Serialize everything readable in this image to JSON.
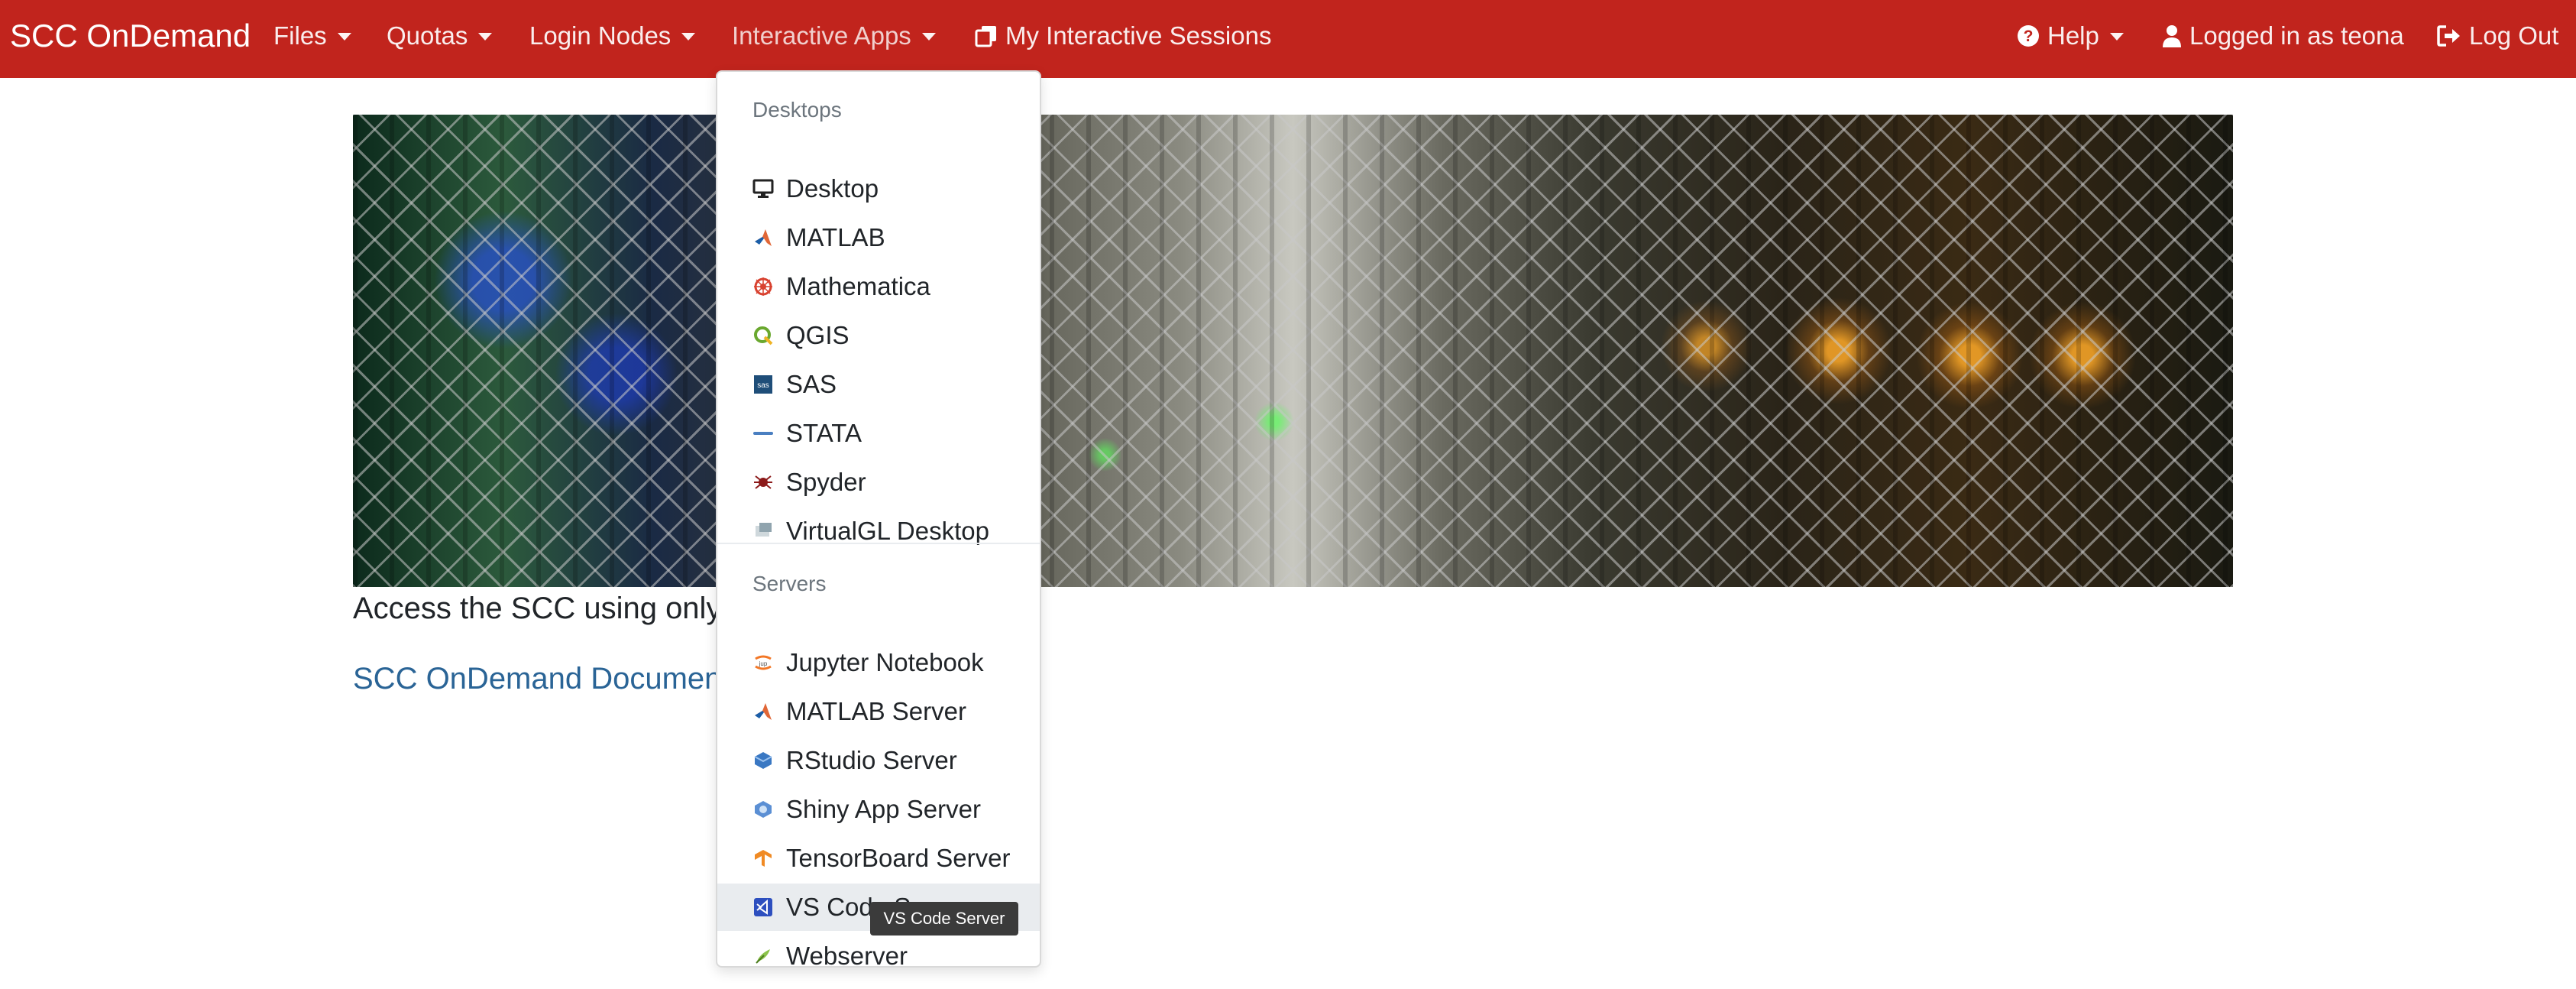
{
  "navbar": {
    "brand": "SCC OnDemand",
    "items": [
      {
        "label": "Files"
      },
      {
        "label": "Quotas"
      },
      {
        "label": "Login Nodes"
      },
      {
        "label": "Interactive Apps"
      },
      {
        "label": "My Interactive Sessions"
      }
    ],
    "help": "Help",
    "logged_in": "Logged in as teona",
    "logout": "Log Out"
  },
  "main": {
    "lead_text": "Access the SCC using only your web browser.",
    "doc_link": "SCC OnDemand Documentation"
  },
  "dropdown": {
    "desktops_header": "Desktops",
    "desktops": [
      {
        "label": "Desktop",
        "icon": "monitor-icon"
      },
      {
        "label": "MATLAB",
        "icon": "matlab-icon"
      },
      {
        "label": "Mathematica",
        "icon": "mathematica-icon"
      },
      {
        "label": "QGIS",
        "icon": "qgis-icon"
      },
      {
        "label": "SAS",
        "icon": "sas-icon"
      },
      {
        "label": "STATA",
        "icon": "stata-icon"
      },
      {
        "label": "Spyder",
        "icon": "spyder-icon"
      },
      {
        "label": "VirtualGL Desktop",
        "icon": "virtualgl-icon"
      }
    ],
    "servers_header": "Servers",
    "servers": [
      {
        "label": "Jupyter Notebook",
        "icon": "jupyter-icon"
      },
      {
        "label": "MATLAB Server",
        "icon": "matlab-icon"
      },
      {
        "label": "RStudio Server",
        "icon": "rstudio-icon"
      },
      {
        "label": "Shiny App Server",
        "icon": "shiny-icon"
      },
      {
        "label": "TensorBoard Server",
        "icon": "tensorboard-icon"
      },
      {
        "label": "VS Code Server",
        "icon": "vscode-icon"
      },
      {
        "label": "Webserver",
        "icon": "webserver-icon"
      }
    ]
  },
  "tooltip": "VS Code Server",
  "colors": {
    "navbar": "#c1241d",
    "link": "#2a6496"
  }
}
